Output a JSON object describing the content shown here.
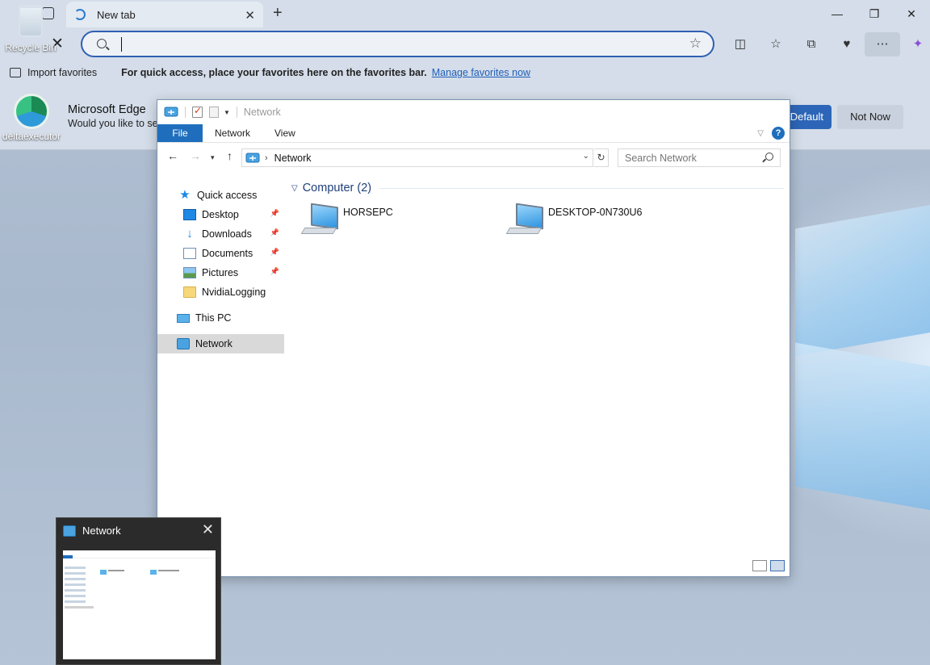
{
  "desktop": {
    "icons": [
      {
        "label": "Recycle Bin"
      },
      {
        "label": "deltaexecutor"
      }
    ]
  },
  "browser": {
    "tab_title": "New tab",
    "address_value": "",
    "favorites_bar": {
      "import_label": "Import favorites",
      "message": "For quick access, place your favorites here on the favorites bar.",
      "manage_link": "Manage favorites now"
    },
    "default_prompt": {
      "title": "Microsoft Edge",
      "subtitle": "Would you like to se",
      "default_button": "Default",
      "not_now_button": "Not Now"
    },
    "window_controls": [
      "—",
      "❐",
      "✕"
    ]
  },
  "explorer": {
    "title": "Network",
    "ribbon_tabs": [
      "File",
      "Network",
      "View"
    ],
    "help_label": "?",
    "breadcrumb": "Network",
    "search_placeholder": "Search Network",
    "nav_pane": {
      "quick_access": "Quick access",
      "items": [
        {
          "label": "Desktop",
          "pinned": true
        },
        {
          "label": "Downloads",
          "pinned": true
        },
        {
          "label": "Documents",
          "pinned": true
        },
        {
          "label": "Pictures",
          "pinned": true
        },
        {
          "label": "NvidiaLogging",
          "pinned": false
        }
      ],
      "this_pc": "This PC",
      "network": "Network",
      "selected": "Network"
    },
    "group": {
      "title": "Computer (2)",
      "computers": [
        "HORSEPC",
        "DESKTOP-0N730U6"
      ]
    }
  },
  "taskbar_thumbnail": {
    "title": "Network",
    "close_label": "✕"
  },
  "colors": {
    "accent": "#1f6ebd",
    "edge_focus": "#2f5fb3",
    "group_header": "#1e3f7a"
  }
}
